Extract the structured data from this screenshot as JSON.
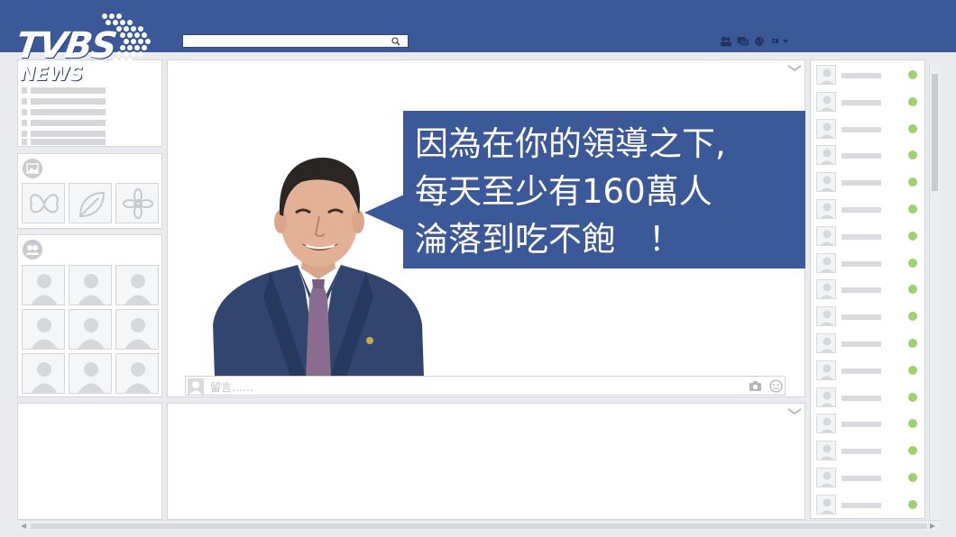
{
  "branding": {
    "logo_text_main": "TVBS",
    "logo_text_sub": "NEWS"
  },
  "search": {
    "value": "",
    "icon": "search-icon"
  },
  "top_icons": [
    "friends-icon",
    "messages-icon",
    "globe-icon",
    "account-menu-icon"
  ],
  "left_column": {
    "menu_lines": 6,
    "photos_section_icon": "photo-icon",
    "photo_thumbs": [
      "butterfly-icon",
      "leaf-icon",
      "flower-icon"
    ],
    "friends_section_icon": "group-icon",
    "friend_thumbs": 9
  },
  "post": {
    "quote": "因為在你的領導之下,\n每天至少有160萬人\n淪落到吃不飽　！",
    "comment_placeholder": "留言……",
    "comment_icons": [
      "camera-icon",
      "emoji-icon"
    ]
  },
  "right_column": {
    "online_friends": 17,
    "status_color": "#9fd071"
  },
  "colors": {
    "brand_blue": "#3b5998",
    "background": "#e9ebee",
    "panel": "#ffffff"
  }
}
